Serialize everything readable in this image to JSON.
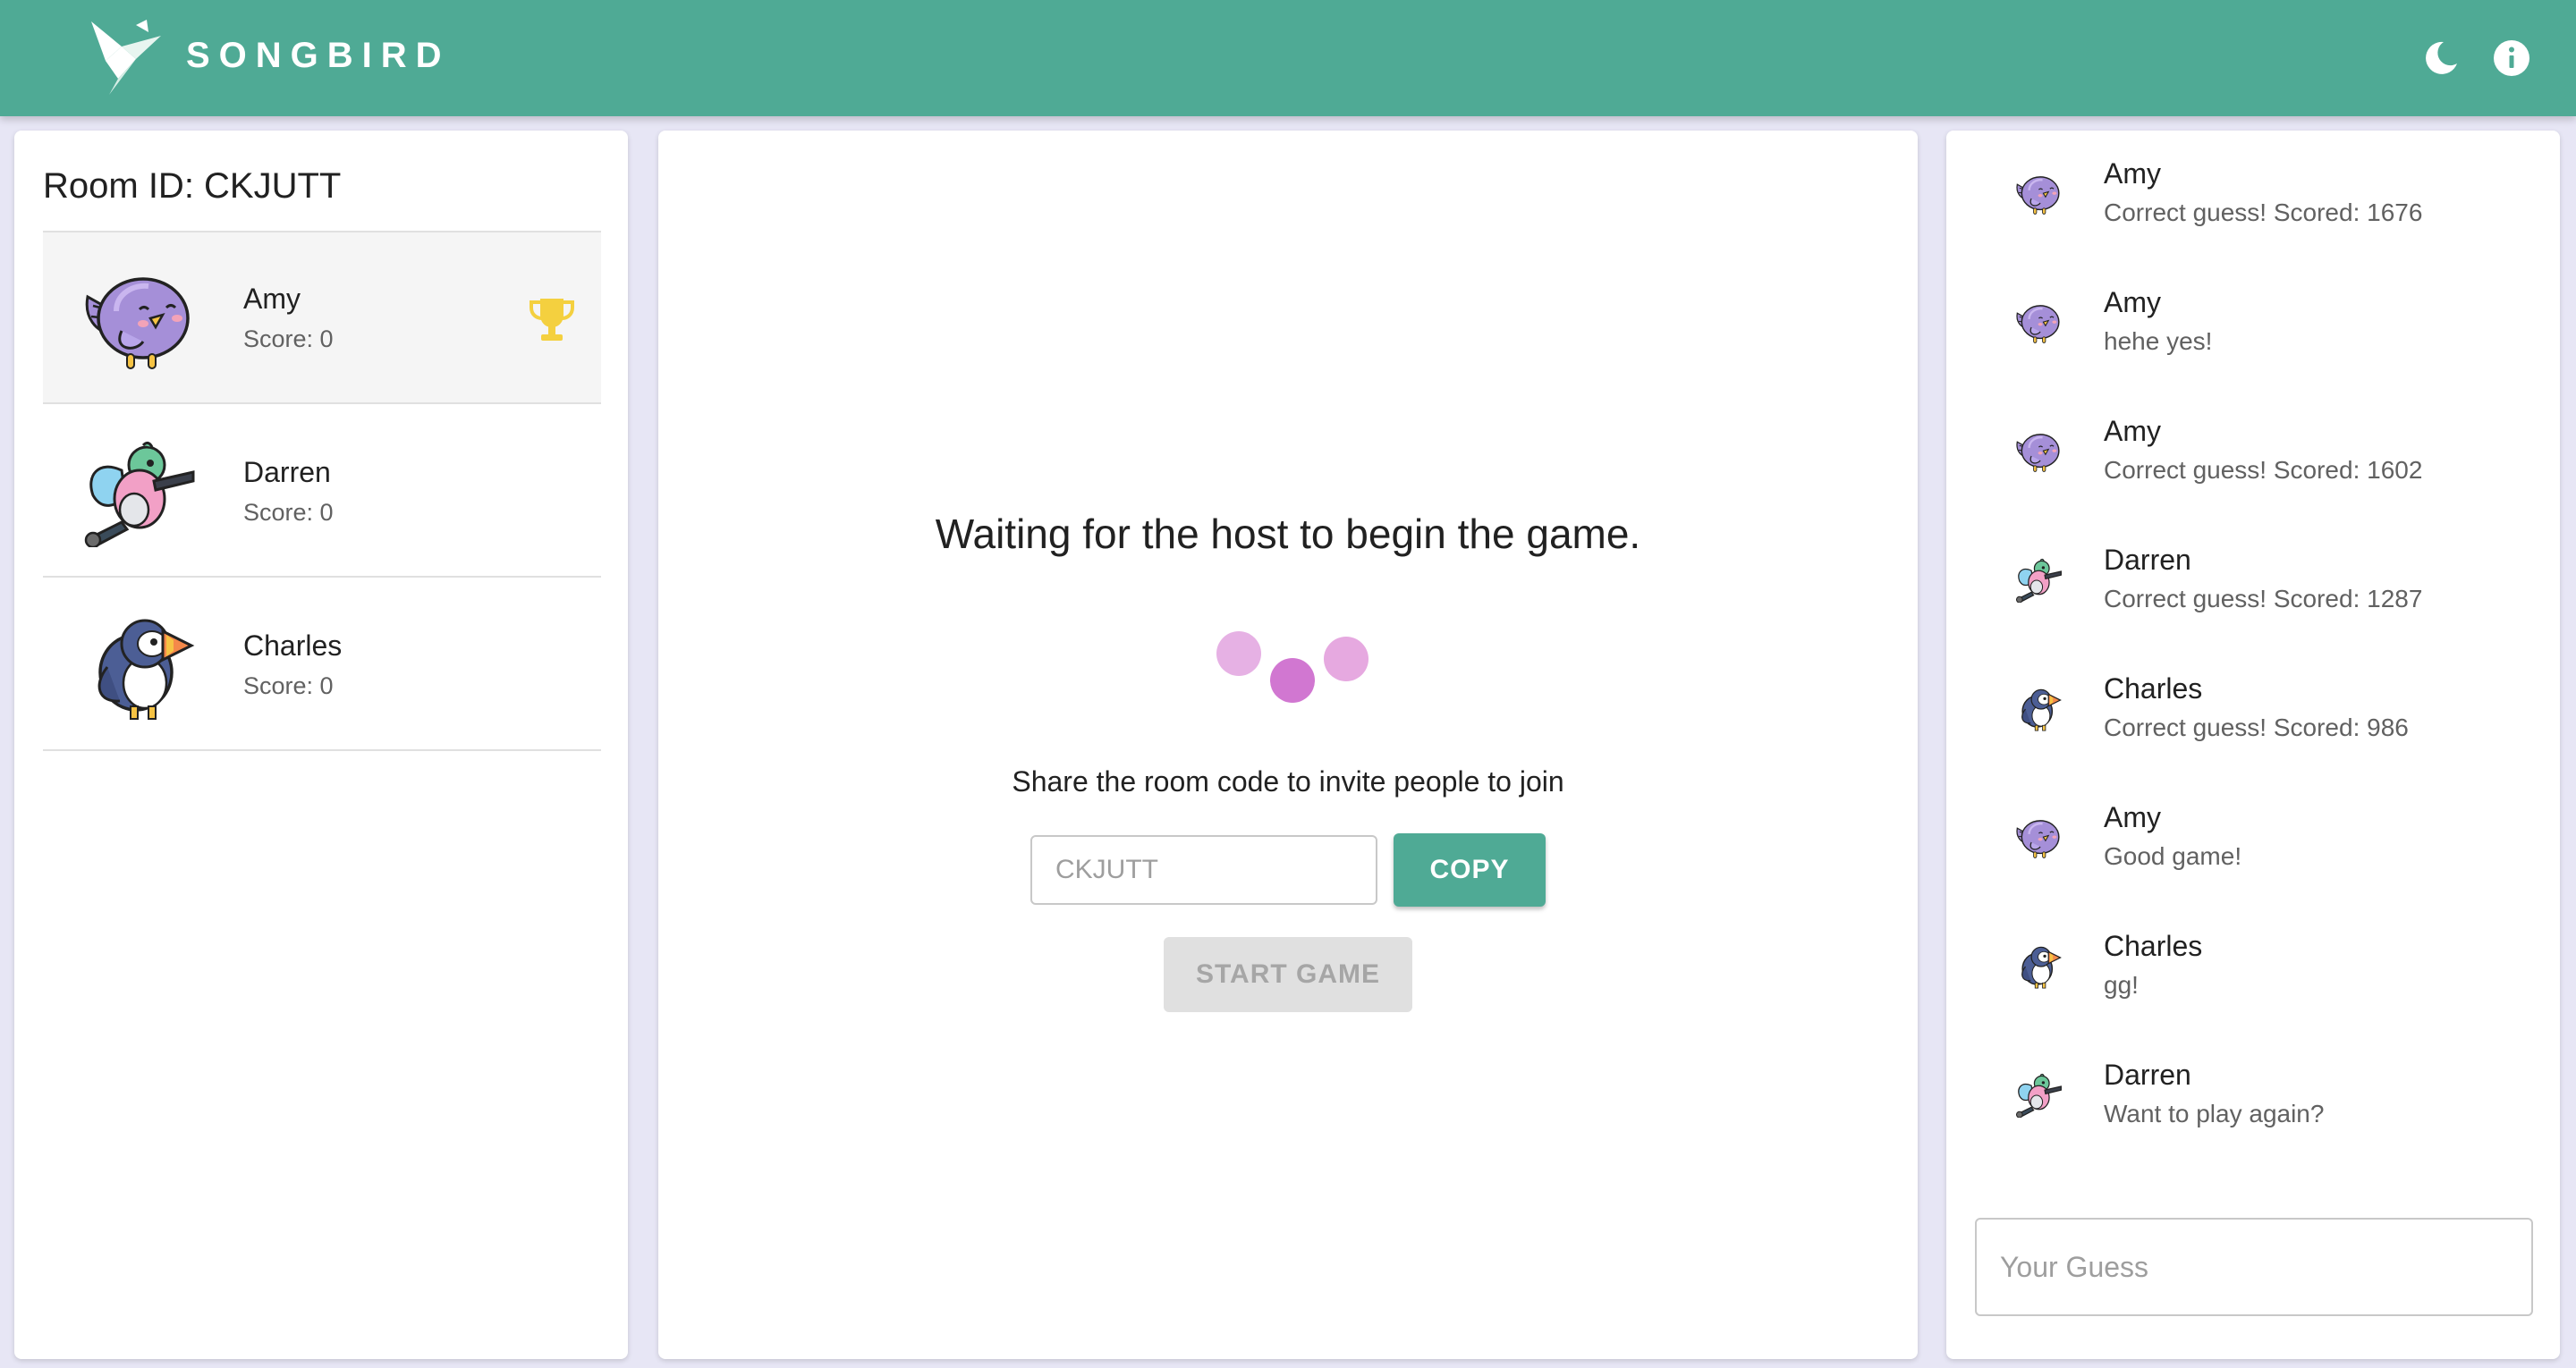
{
  "app": {
    "title": "SONGBIRD"
  },
  "header": {
    "theme_icon": "moon-icon",
    "info_icon": "info-icon"
  },
  "room": {
    "label": "Room ID: CKJUTT"
  },
  "players": [
    {
      "name": "Amy",
      "score": "Score: 0",
      "avatar": "purple-bird",
      "leader": true
    },
    {
      "name": "Darren",
      "score": "Score: 0",
      "avatar": "hummingbird",
      "leader": false
    },
    {
      "name": "Charles",
      "score": "Score: 0",
      "avatar": "puffin",
      "leader": false
    }
  ],
  "lobby": {
    "waiting_text": "Waiting for the host to begin the game.",
    "share_text": "Share the room code to invite people to join",
    "room_code_value": "CKJUTT",
    "copy_label": "COPY",
    "start_label": "START GAME"
  },
  "chat": {
    "messages": [
      {
        "name": "Amy",
        "text": "Correct guess! Scored: 1676",
        "avatar": "purple-bird"
      },
      {
        "name": "Amy",
        "text": "hehe yes!",
        "avatar": "purple-bird"
      },
      {
        "name": "Amy",
        "text": "Correct guess! Scored: 1602",
        "avatar": "purple-bird"
      },
      {
        "name": "Darren",
        "text": "Correct guess! Scored: 1287",
        "avatar": "hummingbird"
      },
      {
        "name": "Charles",
        "text": "Correct guess! Scored: 986",
        "avatar": "puffin"
      },
      {
        "name": "Amy",
        "text": "Good game!",
        "avatar": "purple-bird"
      },
      {
        "name": "Charles",
        "text": "gg!",
        "avatar": "puffin"
      },
      {
        "name": "Darren",
        "text": "Want to play again?",
        "avatar": "hummingbird"
      }
    ],
    "guess_placeholder": "Your Guess"
  },
  "colors": {
    "primary": "#4faa95",
    "background": "#e7e6f5",
    "trophy": "#f4d03f",
    "loader_dot": "#d177d1"
  }
}
